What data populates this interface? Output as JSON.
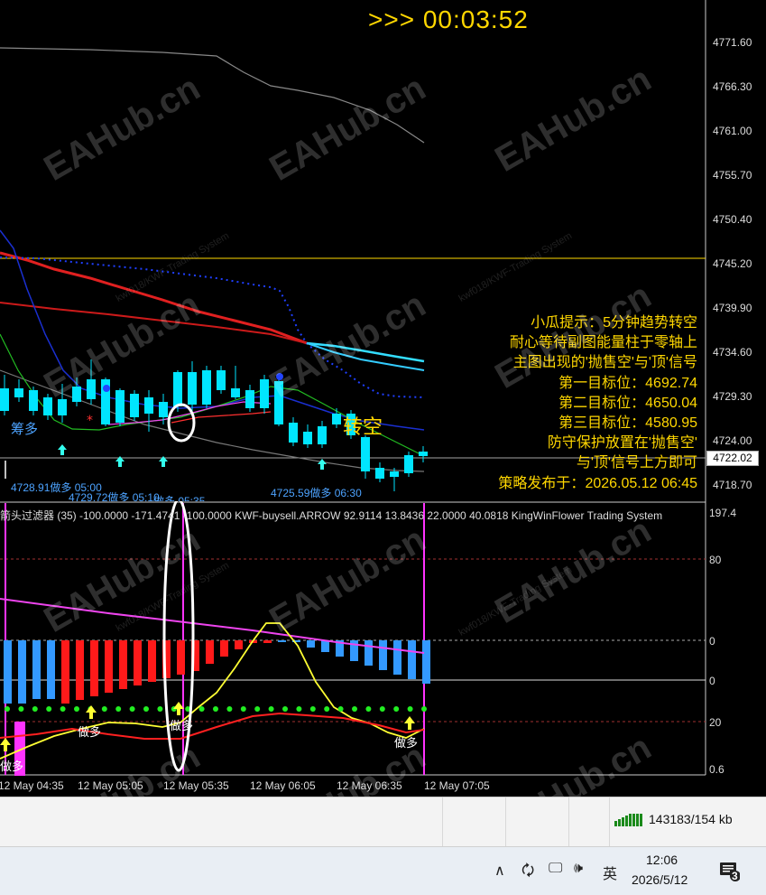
{
  "timer": ">>> 00:03:52",
  "price_axis": [
    "4771.60",
    "4766.30",
    "4761.00",
    "4755.70",
    "4750.40",
    "4745.20",
    "4739.90",
    "4734.60",
    "4729.30",
    "4724.00",
    "4718.70"
  ],
  "current_price": "4722.02",
  "tips": {
    "line1": "小瓜提示：5分钟趋势转空",
    "line2": "耐心等待副图能量柱于零轴上",
    "line3": "主图出现的'抛售空'与'顶'信号",
    "t1_label": "第一目标位：",
    "t1_value": "4692.74",
    "t2_label": "第二目标位：",
    "t2_value": "4650.04",
    "t3_label": "第三目标位：",
    "t3_value": "4580.95",
    "line7": "防守保护放置在'抛售空'",
    "line8": "与'顶'信号上方即可",
    "pub_label": "策略发布于：",
    "pub_value": "2026.05.12 06:45"
  },
  "signals": {
    "zhuan_kong": "转空",
    "chou_duo": "筹多",
    "label1": "4728.91做多 05:00",
    "label2": "4729.72做多 05:10",
    "label3": "做多 05:35",
    "label4": "4725.59做多 06:30"
  },
  "indicator_header": "箭头过滤器 (35) -100.0000 -171.4741 -100.0000  KWF-buysell.ARROW 92.9114 13.8436 22.0000 40.0818  KingWinFlower Trading System",
  "sub_axis": [
    "197.4",
    "80",
    "0",
    "0",
    "20",
    "0.6"
  ],
  "sub_labels": {
    "zuoduo1": "做多",
    "zuoduo2": "做多",
    "zuoduo3": "做多",
    "zuoduo4": "做多"
  },
  "time_axis": [
    "12 May 04:35",
    "12 May 05:05",
    "12 May 05:35",
    "12 May 06:05",
    "12 May 06:35",
    "12 May 07:05"
  ],
  "taskbar": {
    "kb_status": "143183/154 kb",
    "ime": "英",
    "clock_time": "12:06",
    "clock_date": "2026/5/12",
    "notification_count": "3"
  },
  "watermark": "EAHub.cn",
  "watermark_small": "kwf018/KWF-Trading System",
  "colors": {
    "gold": "#ffd700",
    "up": "#00e5ff",
    "down": "#3399ff",
    "red": "#ff2020",
    "magenta": "#ff33ff",
    "yellow": "#ffff33",
    "green": "#22dd22"
  }
}
